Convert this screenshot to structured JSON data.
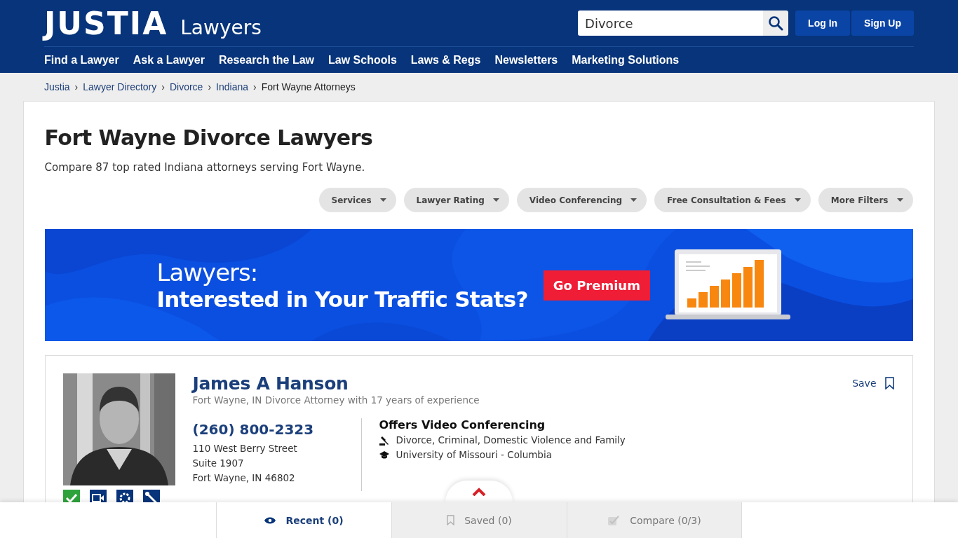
{
  "header": {
    "logo": "JUSTIA",
    "logo_sub": "Lawyers",
    "search": {
      "value": "Divorce"
    },
    "buttons": [
      "Log In",
      "Sign Up"
    ]
  },
  "nav": [
    "Find a Lawyer",
    "Ask a Lawyer",
    "Research the Law",
    "Law Schools",
    "Laws & Regs",
    "Newsletters",
    "Marketing Solutions"
  ],
  "breadcrumb_separator": "›",
  "breadcrumbs": [
    {
      "label": "Justia",
      "link": true
    },
    {
      "label": "Lawyer Directory",
      "link": true
    },
    {
      "label": "Divorce",
      "link": true
    },
    {
      "label": "Indiana",
      "link": true
    },
    {
      "label": "Fort Wayne Attorneys",
      "link": false
    }
  ],
  "title": "Fort Wayne Divorce Lawyers",
  "subtitle": "Compare 87 top rated Indiana attorneys serving Fort Wayne.",
  "filters": [
    "Services",
    "Lawyer Rating",
    "Video Conferencing",
    "Free Consultation & Fees",
    "More Filters"
  ],
  "banner": {
    "line1": "Lawyers:",
    "line2": "Interested in Your Traffic Stats?",
    "button": "Go Premium"
  },
  "lawyer": {
    "name": "James A Hanson",
    "tagline": "Fort Wayne, IN Divorce Attorney with 17 years of experience",
    "phone": "(260) 800-2323",
    "address": [
      "110 West Berry Street",
      "Suite 1907",
      "Fort Wayne, IN 46802"
    ],
    "feature": "Offers Video Conferencing",
    "details": [
      {
        "kind": "practice",
        "text": "Divorce, Criminal, Domestic Violence and Family"
      },
      {
        "kind": "education",
        "text": "University of Missouri - Columbia"
      }
    ],
    "save": "Save",
    "badges": [
      {
        "kind": "verified"
      },
      {
        "kind": "video"
      },
      {
        "kind": "gear"
      },
      {
        "kind": "wrench"
      }
    ]
  },
  "bottom_tabs": [
    {
      "kind": "recent",
      "label": "Recent (0)",
      "selected": true
    },
    {
      "kind": "saved",
      "label": "Saved (0)",
      "selected": false
    },
    {
      "kind": "compare",
      "label": "Compare (0/3)",
      "selected": false
    }
  ]
}
